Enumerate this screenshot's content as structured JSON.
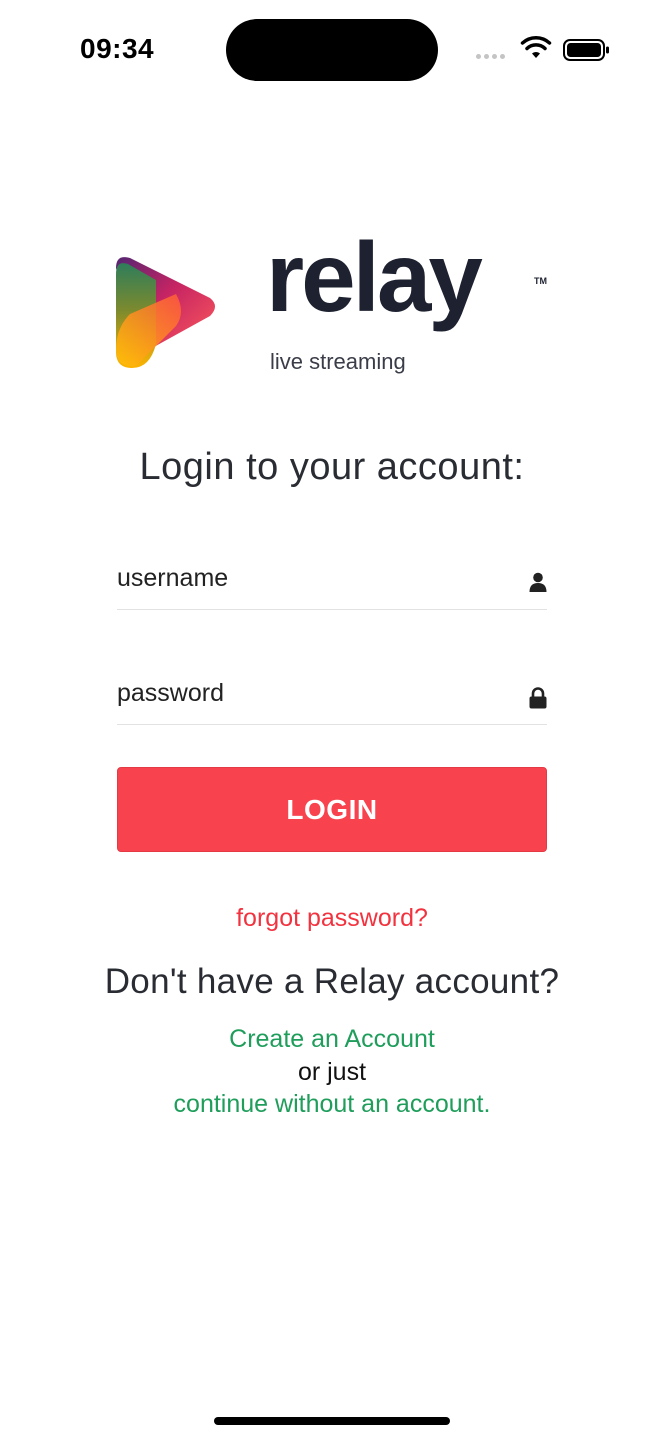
{
  "status_bar": {
    "time": "09:34",
    "icons": [
      "signal-icon",
      "wifi-icon",
      "battery-icon"
    ]
  },
  "logo": {
    "wordmark": "relay",
    "trademark": "TM",
    "tagline": "live streaming"
  },
  "login": {
    "heading": "Login to your account:",
    "username_placeholder": "username",
    "password_placeholder": "password",
    "button_label": "LOGIN",
    "forgot_label": "forgot password?"
  },
  "signup": {
    "prompt": "Don't have a Relay account?",
    "create_label": "Create an Account",
    "or_just": "or just",
    "continue_label": "continue without an account."
  },
  "colors": {
    "accent": "#f8434e",
    "link_red": "#f2333f",
    "link_green": "#1f9d5b"
  }
}
